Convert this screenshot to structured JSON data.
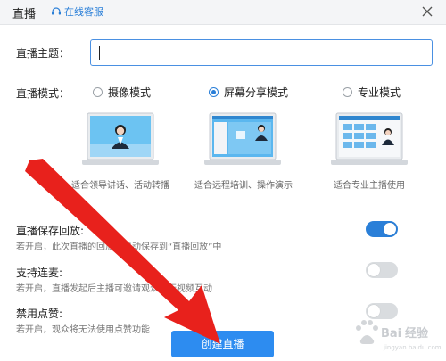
{
  "window": {
    "title": "直播",
    "support_label": "在线客服",
    "close_icon": "close-icon"
  },
  "topic": {
    "label": "直播主题：",
    "value": ""
  },
  "mode": {
    "label": "直播模式：",
    "options": [
      {
        "label": "摄像模式",
        "checked": false,
        "desc": "适合领导讲话、活动转播"
      },
      {
        "label": "屏幕分享模式",
        "checked": true,
        "desc": "适合远程培训、操作演示"
      },
      {
        "label": "专业模式",
        "checked": false,
        "desc": "适合专业主播使用"
      }
    ]
  },
  "settings": [
    {
      "title": "直播保存回放:",
      "desc": "若开启，此次直播的回放将自动保存到“直播回放”中",
      "on": true
    },
    {
      "title": "支持连麦:",
      "desc": "若开启，直播发起后主播可邀请观众进行视频互动",
      "on": false
    },
    {
      "title": "禁用点赞:",
      "desc": "若开启，观众将无法使用点赞功能",
      "on": false
    }
  ],
  "create_button": {
    "label": "创建直播"
  },
  "colors": {
    "accent": "#2d8cf0",
    "annotation_arrow": "#e8211c"
  }
}
